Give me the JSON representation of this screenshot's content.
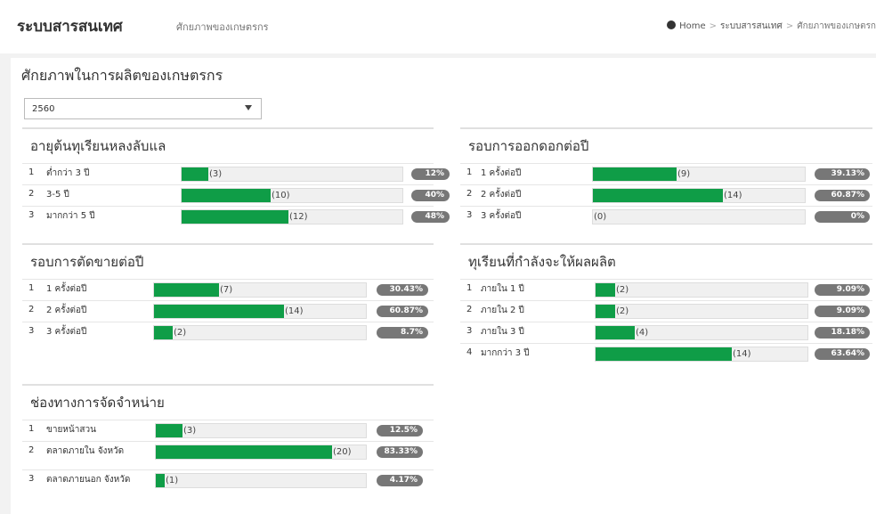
{
  "header": {
    "title": "ระบบสารสนเทศ",
    "subtitle": "ศักยภาพของเกษตรกร",
    "breadcrumb": [
      "Home",
      "ระบบสารสนเทศ",
      "ศักยภาพของเกษตรก"
    ]
  },
  "page": {
    "title": "ศักยภาพในการผลิตของเกษตรกร",
    "year_selected": "2560"
  },
  "panels": [
    {
      "title": "อายุต้นทุเรียนหลงลับแล",
      "rows": [
        {
          "num": "1",
          "label": "ต่ำกว่า 3 ปี",
          "count": "(3)",
          "pct": "12%",
          "fraction": 0.12
        },
        {
          "num": "2",
          "label": "3-5 ปี",
          "count": "(10)",
          "pct": "40%",
          "fraction": 0.4
        },
        {
          "num": "3",
          "label": "มากกว่า 5 ปี",
          "count": "(12)",
          "pct": "48%",
          "fraction": 0.48
        }
      ]
    },
    {
      "title": "รอบการออกดอกต่อปี",
      "rows": [
        {
          "num": "1",
          "label": "1 ครั้งต่อปี",
          "count": "(9)",
          "pct": "39.13%",
          "fraction": 0.3913
        },
        {
          "num": "2",
          "label": "2 ครั้งต่อปี",
          "count": "(14)",
          "pct": "60.87%",
          "fraction": 0.6087
        },
        {
          "num": "3",
          "label": "3 ครั้งต่อปี",
          "count": "(0)",
          "pct": "0%",
          "fraction": 0
        }
      ]
    },
    {
      "title": "รอบการตัดขายต่อปี",
      "rows": [
        {
          "num": "1",
          "label": "1 ครั้งต่อปี",
          "count": "(7)",
          "pct": "30.43%",
          "fraction": 0.3043
        },
        {
          "num": "2",
          "label": "2 ครั้งต่อปี",
          "count": "(14)",
          "pct": "60.87%",
          "fraction": 0.6087
        },
        {
          "num": "3",
          "label": "3 ครั้งต่อปี",
          "count": "(2)",
          "pct": "8.7%",
          "fraction": 0.087
        }
      ]
    },
    {
      "title": "ทุเรียนที่กำลังจะให้ผลผลิต",
      "rows": [
        {
          "num": "1",
          "label": "ภายใน 1 ปี",
          "count": "(2)",
          "pct": "9.09%",
          "fraction": 0.0909
        },
        {
          "num": "2",
          "label": "ภายใน 2 ปี",
          "count": "(2)",
          "pct": "9.09%",
          "fraction": 0.0909
        },
        {
          "num": "3",
          "label": "ภายใน 3 ปี",
          "count": "(4)",
          "pct": "18.18%",
          "fraction": 0.1818
        },
        {
          "num": "4",
          "label": "มากกว่า 3 ปี",
          "count": "(14)",
          "pct": "63.64%",
          "fraction": 0.6364
        }
      ]
    },
    {
      "title": "ช่องทางการจัดจำหน่าย",
      "rows": [
        {
          "num": "1",
          "label": "ขายหน้าสวน",
          "count": "(3)",
          "pct": "12.5%",
          "fraction": 0.125
        },
        {
          "num": "2",
          "label": "ตลาดภายใน จังหวัด",
          "count": "(20)",
          "pct": "83.33%",
          "fraction": 0.8333
        },
        {
          "num": "3",
          "label": "ตลาดภายนอก จังหวัด",
          "count": "(1)",
          "pct": "4.17%",
          "fraction": 0.0417
        }
      ]
    }
  ],
  "colors": {
    "bar_fill": "#0f9d47",
    "badge": "#777777"
  }
}
